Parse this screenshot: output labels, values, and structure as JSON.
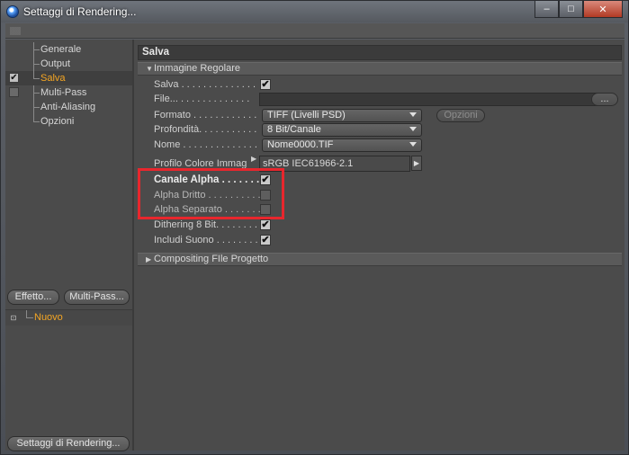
{
  "window": {
    "title": "Settaggi di Rendering...",
    "buttons": {
      "minimize": "–",
      "maximize": "□",
      "close": "✕"
    }
  },
  "sidebar": {
    "items": [
      {
        "label": "Generale",
        "checkbox": false,
        "checked": false,
        "selected": false
      },
      {
        "label": "Output",
        "checkbox": false,
        "checked": false,
        "selected": false
      },
      {
        "label": "Salva",
        "checkbox": true,
        "checked": true,
        "selected": true
      },
      {
        "label": "Multi-Pass",
        "checkbox": true,
        "checked": false,
        "selected": false
      },
      {
        "label": "Anti-Aliasing",
        "checkbox": false,
        "checked": false,
        "selected": false
      },
      {
        "label": "Opzioni",
        "checkbox": false,
        "checked": false,
        "selected": false
      }
    ],
    "effect_button": "Effetto...",
    "multipass_button": "Multi-Pass...",
    "settings_list": [
      {
        "label": "Nuovo"
      }
    ],
    "render_settings_button": "Settaggi di Rendering..."
  },
  "main": {
    "section_title": "Salva",
    "group_regular": "Immagine Regolare",
    "group_compositing": "Compositing FIle Progetto",
    "rows": {
      "salva": {
        "label": "Salva . . . . . . . . . . . . . .",
        "checked": true
      },
      "file": {
        "label": "File... . . . . . . . . . . . . .",
        "value": "",
        "browse": "..."
      },
      "formato": {
        "label": "Formato . . . . . . . . . . . .",
        "value": "TIFF  (Livelli PSD)",
        "options_button": "Opzioni"
      },
      "profondita": {
        "label": "Profondità. . . . . . . . . . .",
        "value": "8 Bit/Canale"
      },
      "nome": {
        "label": "Nome . . . . . . . . . . . . . .",
        "value": "Nome0000.TIF"
      },
      "profilo": {
        "label": "Profilo Colore Immagine",
        "value": "sRGB IEC61966-2.1"
      },
      "canale_alpha": {
        "label": "Canale Alpha . . . . . . . .",
        "checked": true
      },
      "alpha_dritto": {
        "label": "Alpha Dritto . . . . . . . . . .",
        "checked": false
      },
      "alpha_separato": {
        "label": "Alpha Separato . . . . . . . .",
        "checked": false
      },
      "dithering": {
        "label": "Dithering 8 Bit. . . . . . . .",
        "checked": true
      },
      "suono": {
        "label": "Includi Suono . . . . . . . . .",
        "checked": true
      }
    }
  },
  "colors": {
    "accent": "#f5a623",
    "highlight": "#e8262d",
    "panel": "#4b4b4b"
  },
  "icons": {
    "app": "cinema4d-icon",
    "check": "✔",
    "expand": "▼",
    "collapse": "▶"
  }
}
